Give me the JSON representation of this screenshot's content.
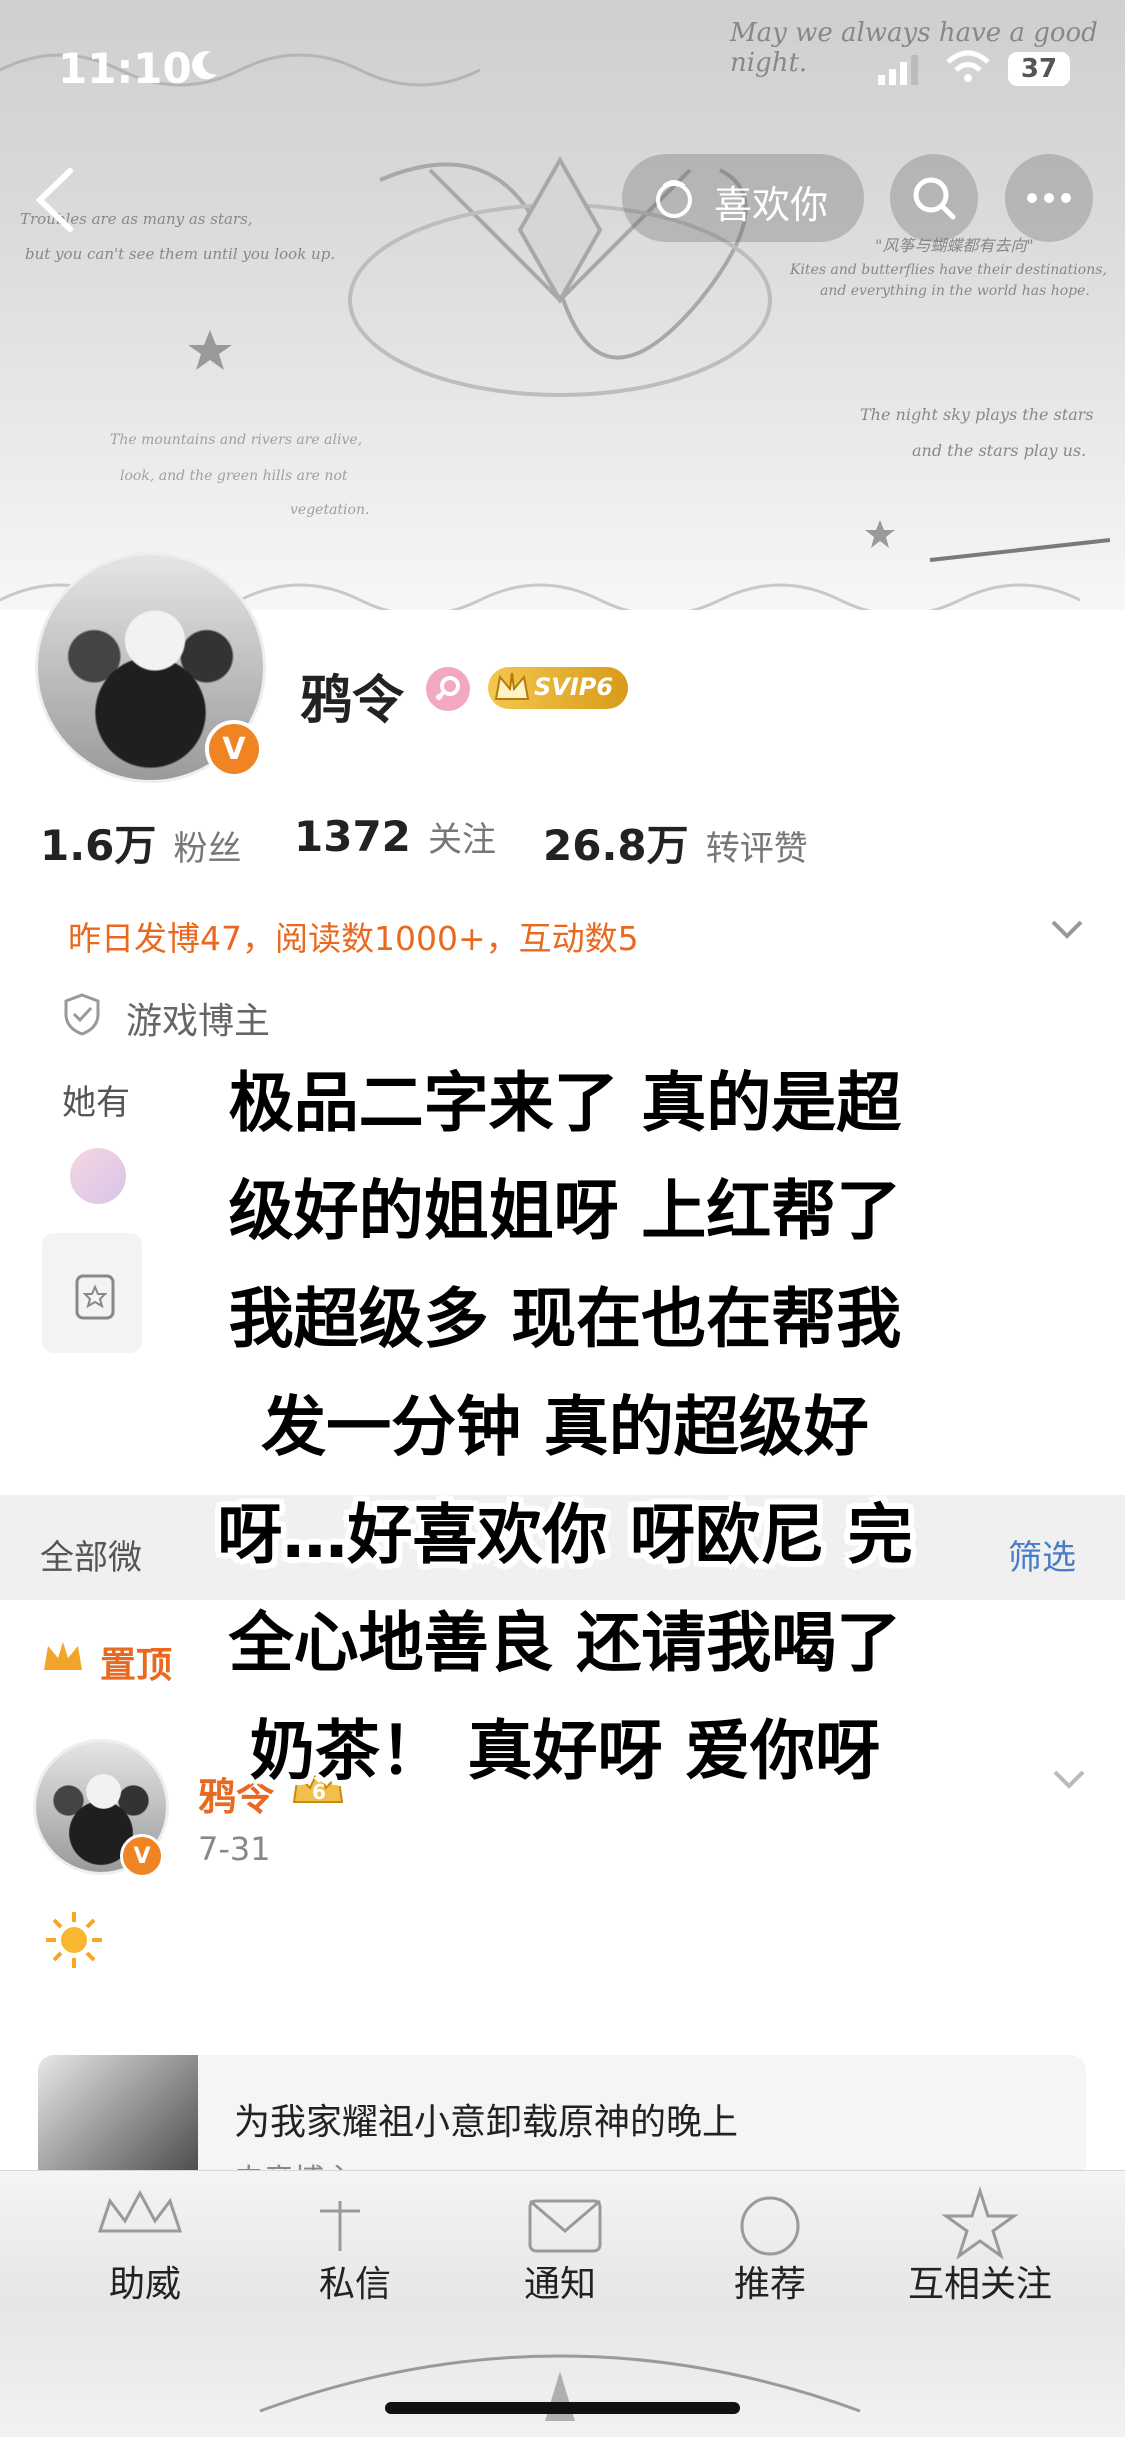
{
  "status_bar": {
    "time": "11:10",
    "battery": "37"
  },
  "header": {
    "like_button_label": "喜欢你",
    "banner_texts": [
      "May we always have a good night.",
      "Troubles are as many as stars,",
      "but you can't see them until you look up.",
      "\"风筝与蝴蝶都有去向\"",
      "Kites and butterflies have their destinations,",
      "and everything in the world has hope.",
      "The night sky plays the stars",
      "and the stars play us.",
      "The mountains and rivers are alive,",
      "look, and the green hills are not",
      "vegetation."
    ]
  },
  "profile": {
    "name": "鸦令",
    "svip_label": "SVIP6",
    "stats": [
      {
        "num": "1.6万",
        "label": "粉丝"
      },
      {
        "num": "1372",
        "label": "关注"
      },
      {
        "num": "26.8万",
        "label": "转评赞"
      }
    ],
    "activity": "昨日发博47，阅读数1000+，互动数5",
    "tag": "游戏博主",
    "she_has": "她有"
  },
  "feed": {
    "tab_label": "全部微",
    "filter_label": "筛选",
    "pinned_label": "置顶",
    "post": {
      "author": "鸦令",
      "vip_level": "6",
      "date": "7-31",
      "card_title": "为我家耀祖小意卸载原神的晚上",
      "card_subtitle": "电竞博主"
    }
  },
  "overlay_lines": [
    "极品二字来了 真的是超",
    "级好的姐姐呀 上红帮了",
    "我超级多 现在也在帮我",
    "发一分钟 真的超级好",
    "呀…好喜欢你 呀欧尼 完",
    "全心地善良 还请我喝了",
    "奶茶！ 真好呀 爱你呀"
  ],
  "bottom_tabs": [
    "助威",
    "私信",
    "通知",
    "推荐",
    "互相关注"
  ],
  "colors": {
    "accent": "#f08322",
    "activity": "#e8691f",
    "gold": "#d4a017"
  }
}
